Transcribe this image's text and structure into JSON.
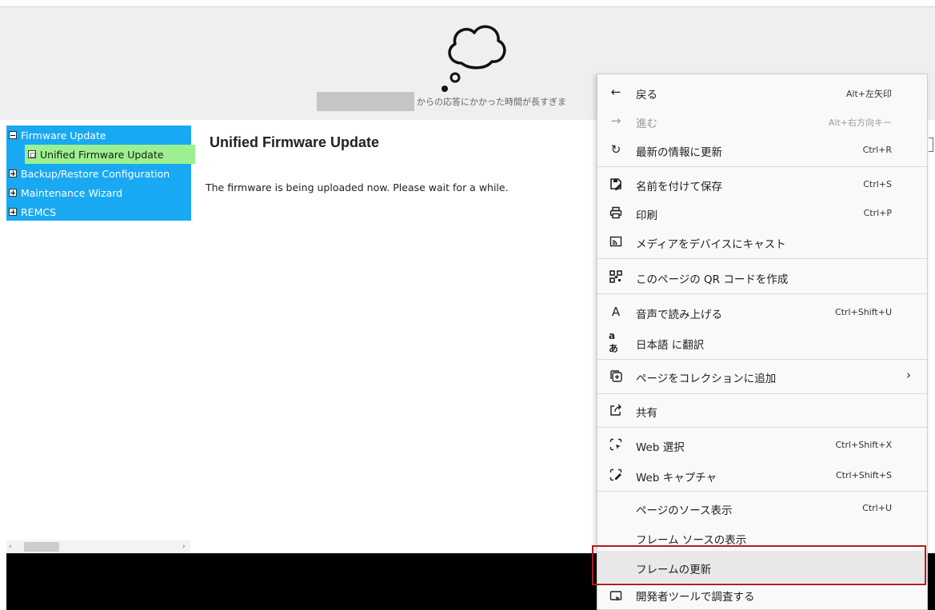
{
  "banner": {
    "message": "からの応答にかかった時間が長すぎま"
  },
  "tree": {
    "items": [
      {
        "label": "Firmware Update",
        "expander": "minus"
      },
      {
        "label": "Unified Firmware Update",
        "expander": "leaf"
      },
      {
        "label": "Backup/Restore Configuration",
        "expander": "plus"
      },
      {
        "label": "Maintenance Wizard",
        "expander": "plus"
      },
      {
        "label": "REMCS",
        "expander": "plus"
      }
    ],
    "colors": {
      "background": "#19a9f2",
      "selected": "#9cf08f"
    }
  },
  "scrollbar": {
    "left_arrow": "‹",
    "right_arrow": "›"
  },
  "main": {
    "title": "Unified Firmware Update",
    "message": "The firmware is being uploaded now. Please wait for a while."
  },
  "context_menu": {
    "items": [
      {
        "icon": "back-arrow-icon",
        "glyph": "←",
        "label": "戻る",
        "shortcut": "Alt+左矢印"
      },
      {
        "icon": "forward-arrow-icon",
        "glyph": "→",
        "label": "進む",
        "shortcut": "Alt+右方向キー",
        "disabled": true
      },
      {
        "icon": "refresh-icon",
        "glyph": "↻",
        "label": "最新の情報に更新",
        "shortcut": "Ctrl+R"
      },
      {
        "icon": "save-as-icon",
        "glyph": "",
        "label": "名前を付けて保存",
        "shortcut": "Ctrl+S"
      },
      {
        "icon": "print-icon",
        "glyph": "",
        "label": "印刷",
        "shortcut": "Ctrl+P"
      },
      {
        "icon": "cast-icon",
        "glyph": "",
        "label": "メディアをデバイスにキャスト",
        "shortcut": ""
      },
      {
        "icon": "qr-code-icon",
        "glyph": "",
        "label": "このページの QR コードを作成",
        "shortcut": ""
      },
      {
        "icon": "read-aloud-icon",
        "glyph": "A",
        "label": "音声で読み上げる",
        "shortcut": "Ctrl+Shift+U"
      },
      {
        "icon": "translate-icon",
        "glyph": "aあ",
        "label": "日本語 に翻訳",
        "shortcut": ""
      },
      {
        "icon": "collections-icon",
        "glyph": "",
        "label": "ページをコレクションに追加",
        "shortcut": "",
        "submenu": true
      },
      {
        "icon": "share-icon",
        "glyph": "",
        "label": "共有",
        "shortcut": ""
      },
      {
        "icon": "web-select-icon",
        "glyph": "",
        "label": "Web 選択",
        "shortcut": "Ctrl+Shift+X"
      },
      {
        "icon": "web-capture-icon",
        "glyph": "",
        "label": "Web キャプチャ",
        "shortcut": "Ctrl+Shift+S"
      },
      {
        "icon": "",
        "glyph": "",
        "label": "ページのソース表示",
        "shortcut": "Ctrl+U"
      },
      {
        "icon": "",
        "glyph": "",
        "label": "フレーム ソースの表示",
        "shortcut": ""
      },
      {
        "icon": "",
        "glyph": "",
        "label": "フレームの更新",
        "shortcut": "",
        "highlighted": true
      },
      {
        "icon": "devtools-icon",
        "glyph": "",
        "label": "開発者ツールで調査する",
        "shortcut": ""
      }
    ],
    "submenu_arrow": "›",
    "highlight_color": "#b21d22"
  }
}
